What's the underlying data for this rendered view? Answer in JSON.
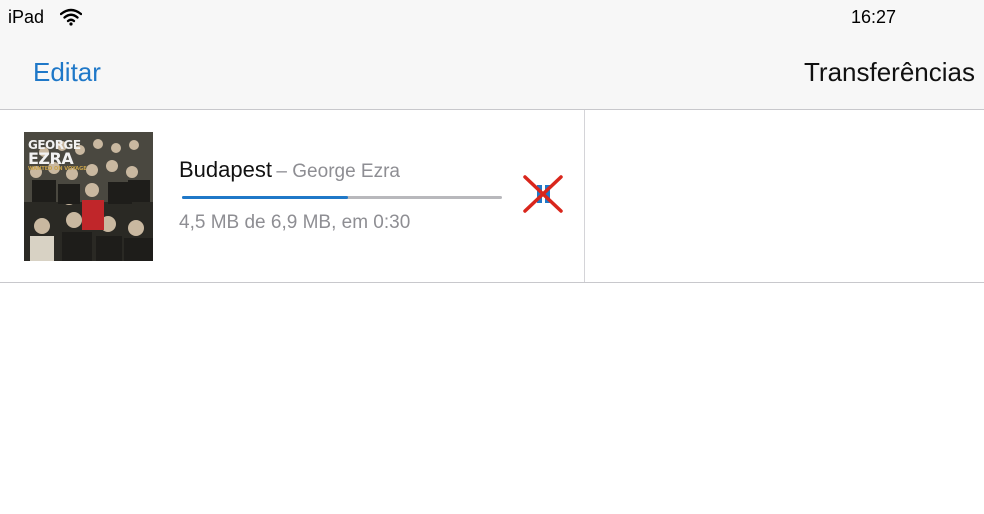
{
  "status_bar": {
    "device": "iPad",
    "time": "16:27",
    "wifi_icon": "wifi-icon"
  },
  "nav": {
    "edit_label": "Editar",
    "title": "Transferências"
  },
  "downloads": [
    {
      "title": "Budapest",
      "separator": "–",
      "artist": "George Ezra",
      "artwork_text": [
        "GEORGE",
        "EZRA",
        "WANTED ON VOYAGE"
      ],
      "progress_text": "4,5 MB de 6,9 MB, em 0:30",
      "progress": 0.52,
      "cancel_icon": "pause-cancel-icon"
    }
  ],
  "colors": {
    "accent": "#1f78c8",
    "cancel_mark": "#d9261c",
    "secondary_text": "#8e8e93"
  }
}
